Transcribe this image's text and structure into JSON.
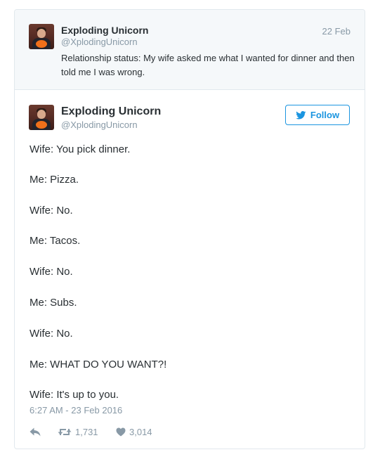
{
  "parent_tweet": {
    "author_name": "Exploding Unicorn",
    "author_handle": "@XplodingUnicorn",
    "date": "22 Feb",
    "text": "Relationship status: My wife asked me what I wanted for dinner and then told me I was wrong."
  },
  "main_tweet": {
    "author_name": "Exploding Unicorn",
    "author_handle": "@XplodingUnicorn",
    "follow_label": "Follow",
    "lines": [
      "Wife: You pick dinner.",
      "Me: Pizza.",
      "Wife: No.",
      "Me: Tacos.",
      "Wife: No.",
      "Me: Subs.",
      "Wife: No.",
      "Me: WHAT DO YOU WANT?!",
      "Wife: It's up to you."
    ],
    "timestamp": "6:27 AM - 23 Feb 2016",
    "retweet_count": "1,731",
    "like_count": "3,014"
  },
  "colors": {
    "accent": "#1b95e0",
    "muted": "#8899a6",
    "text": "#292f33",
    "parent_background": "#f5f8fa"
  },
  "icons": {
    "follow": "twitter-bird-icon",
    "reply": "reply-icon",
    "retweet": "retweet-icon",
    "like": "heart-icon"
  }
}
